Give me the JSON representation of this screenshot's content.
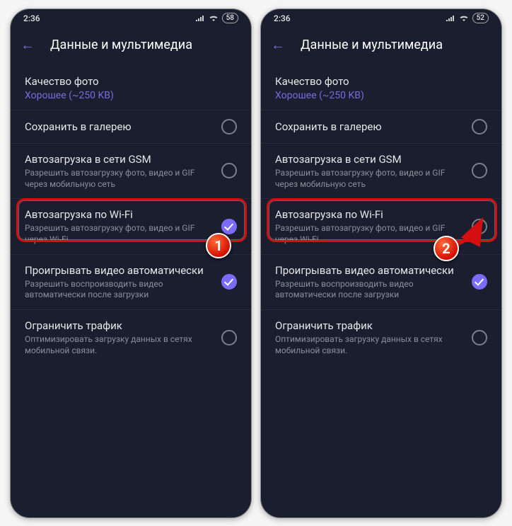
{
  "status": {
    "time": "2:36",
    "battery_left": "58",
    "battery_right": "52"
  },
  "header": {
    "title": "Данные и мультимедиа"
  },
  "rows": {
    "photo_quality": {
      "title": "Качество фото",
      "value": "Хорошее (~250 KB)"
    },
    "save_gallery": {
      "title": "Сохранить в галерею"
    },
    "auto_gsm": {
      "title": "Автозагрузка в сети GSM",
      "sub": "Разрешить автозагрузку фото, видео и GIF через мобильную сеть"
    },
    "auto_wifi": {
      "title": "Автозагрузка по Wi-Fi",
      "sub": "Разрешить автозагрузку фото, видео и GIF через Wi-Fi"
    },
    "autoplay": {
      "title": "Проигрывать видео автоматически",
      "sub": "Разрешить воспроизводить видео автоматически после загрузки"
    },
    "limit": {
      "title": "Ограничить трафик",
      "sub": "Оптимизировать загрузку данных в сетях мобильной связи."
    }
  },
  "callout": {
    "one": "1",
    "two": "2"
  }
}
